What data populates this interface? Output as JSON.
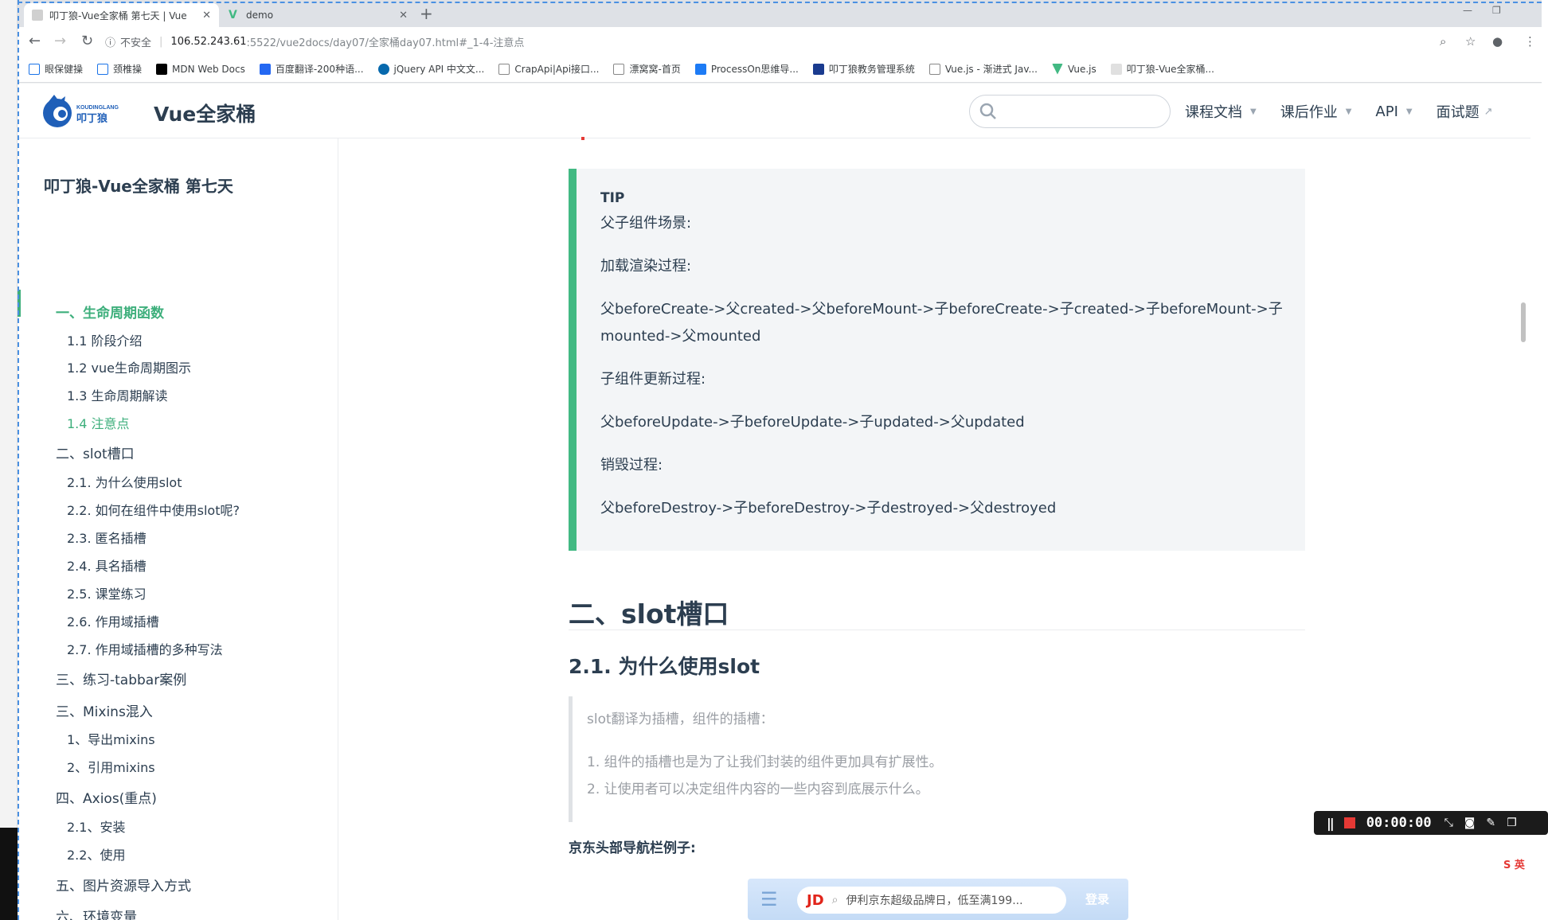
{
  "browser": {
    "tabs": [
      {
        "title": "叩丁狼-Vue全家桶 第七天 | Vue",
        "active": true
      },
      {
        "title": "demo",
        "active": false
      }
    ],
    "security_label": "不安全",
    "url_host": "106.52.243.61",
    "url_rest": ":5522/vue2docs/day07/全家桶day07.html#_1-4-注意点",
    "bookmarks": [
      {
        "label": "眼保健操",
        "color": "#1a73e8"
      },
      {
        "label": "颈椎操",
        "color": "#1a73e8"
      },
      {
        "label": "MDN Web Docs",
        "color": "#000000"
      },
      {
        "label": "百度翻译-200种语...",
        "color": "#2468f2"
      },
      {
        "label": "jQuery API 中文文...",
        "color": "#0769ad"
      },
      {
        "label": "CrapApi|Api接口...",
        "color": "#888888"
      },
      {
        "label": "漂窝窝-首页",
        "color": "#888888"
      },
      {
        "label": "ProcessOn思维导...",
        "color": "#1d7bf5"
      },
      {
        "label": "叩丁狼教务管理系统",
        "color": "#1a3b8f"
      },
      {
        "label": "Vue.js - 渐进式 Jav...",
        "color": "#888888"
      },
      {
        "label": "Vue.js",
        "color": "#42b983"
      },
      {
        "label": "叩丁狼-Vue全家桶...",
        "color": "#cccccc"
      }
    ]
  },
  "site": {
    "logo_text_top": "KOUDINGLANG",
    "logo_text_cn": "叩丁狼",
    "name": "Vue全家桶",
    "nav": [
      {
        "label": "课程文档",
        "caret": true
      },
      {
        "label": "课后作业",
        "caret": true
      },
      {
        "label": "API",
        "caret": true
      },
      {
        "label": "面试题",
        "external": true
      }
    ]
  },
  "sidebar": {
    "title": "叩丁狼-Vue全家桶 第七天",
    "items": [
      {
        "label": "一、生命周期函数",
        "level": 1,
        "state": "active"
      },
      {
        "label": "1.1 阶段介绍",
        "level": 2
      },
      {
        "label": "1.2 vue生命周期图示",
        "level": 2
      },
      {
        "label": "1.3 生命周期解读",
        "level": 2
      },
      {
        "label": "1.4 注意点",
        "level": 2,
        "state": "active-sub"
      },
      {
        "label": "二、slot槽口",
        "level": 1
      },
      {
        "label": "2.1. 为什么使用slot",
        "level": 2
      },
      {
        "label": "2.2. 如何在组件中使用slot呢?",
        "level": 2
      },
      {
        "label": "2.3. 匿名插槽",
        "level": 2
      },
      {
        "label": "2.4. 具名插槽",
        "level": 2
      },
      {
        "label": "2.5. 课堂练习",
        "level": 2
      },
      {
        "label": "2.6. 作用域插槽",
        "level": 2
      },
      {
        "label": "2.7. 作用域插槽的多种写法",
        "level": 2
      },
      {
        "label": "三、练习-tabbar案例",
        "level": 1
      },
      {
        "label": "三、Mixins混入",
        "level": 1
      },
      {
        "label": "1、导出mixins",
        "level": 2
      },
      {
        "label": "2、引用mixins",
        "level": 2
      },
      {
        "label": "四、Axios(重点)",
        "level": 1
      },
      {
        "label": "2.1、安装",
        "level": 2
      },
      {
        "label": "2.2、使用",
        "level": 2
      },
      {
        "label": "五、图片资源导入方式",
        "level": 1
      },
      {
        "label": "六、环境变量",
        "level": 1
      }
    ]
  },
  "tip": {
    "title": "TIP",
    "lines": [
      "父子组件场景:",
      "加载渲染过程:",
      "父beforeCreate->父created->父beforeMount->子beforeCreate->子created->子beforeMount->子mounted->父mounted",
      "子组件更新过程:",
      "父beforeUpdate->子beforeUpdate->子updated->父updated",
      "销毁过程:",
      "父beforeDestroy->子beforeDestroy->子destroyed->父destroyed"
    ]
  },
  "section": {
    "h2": "二、slot槽口",
    "h3": "2.1. 为什么使用slot",
    "quote_intro": "slot翻译为插槽，组件的插槽：",
    "quote_items": [
      "1. 组件的插槽也是为了让我们封装的组件更加具有扩展性。",
      "2. 让使用者可以决定组件内容的一些内容到底展示什么。"
    ],
    "jd_title": "京东头部导航栏例子:",
    "jd_logo": "JD",
    "jd_placeholder": "伊利京东超级品牌日，低至满199...",
    "jd_login": "登录"
  },
  "recorder": {
    "timer": "00:00:00"
  },
  "colors": {
    "accent": "#3eaf7c",
    "tip_border": "#42b983"
  }
}
